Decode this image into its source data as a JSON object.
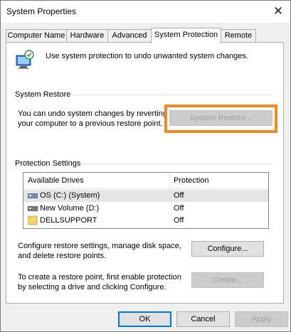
{
  "window": {
    "title": "System Properties"
  },
  "tabs": [
    {
      "label": "Computer Name"
    },
    {
      "label": "Hardware"
    },
    {
      "label": "Advanced"
    },
    {
      "label": "System Protection",
      "active": true
    },
    {
      "label": "Remote"
    }
  ],
  "intro": {
    "text": "Use system protection to undo unwanted system changes."
  },
  "system_restore": {
    "heading": "System Restore",
    "description_line1": "You can undo system changes by reverting",
    "description_line2": "your computer to a previous restore point.",
    "button_label": "System Restore..."
  },
  "protection": {
    "heading": "Protection Settings",
    "columns": {
      "drives": "Available Drives",
      "protection": "Protection"
    },
    "rows": [
      {
        "drive": "OS (C:) (System)",
        "status": "Off",
        "icon": "system-drive-icon"
      },
      {
        "drive": "New Volume (D:)",
        "status": "Off",
        "icon": "drive-icon"
      },
      {
        "drive": "DELLSUPPORT",
        "status": "Off",
        "icon": "folder-icon"
      }
    ],
    "configure_text_line1": "Configure restore settings, manage disk space,",
    "configure_text_line2": "and delete restore points.",
    "configure_label": "Configure...",
    "create_text_line1": "To create a restore point, first enable protection",
    "create_text_line2": "by selecting a drive and clicking Configure.",
    "create_label": "Create..."
  },
  "footer": {
    "ok": "OK",
    "cancel": "Cancel",
    "apply": "Apply"
  },
  "colors": {
    "highlight": "#f28a24",
    "accent": "#0078d7"
  }
}
